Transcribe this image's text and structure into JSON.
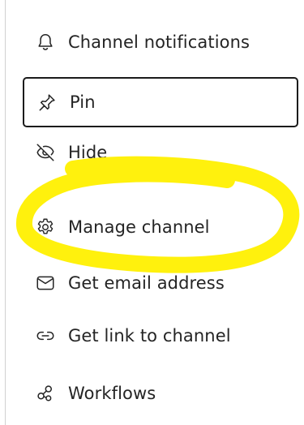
{
  "menu": {
    "items": [
      {
        "label": "Channel notifications",
        "icon": "bell-icon"
      },
      {
        "label": "Pin",
        "icon": "pin-icon"
      },
      {
        "label": "Hide",
        "icon": "eye-off-icon"
      },
      {
        "label": "Manage channel",
        "icon": "gear-icon"
      },
      {
        "label": "Get email address",
        "icon": "mail-icon"
      },
      {
        "label": "Get link to channel",
        "icon": "link-icon"
      },
      {
        "label": "Workflows",
        "icon": "workflows-icon"
      }
    ],
    "focused_item": "Pin"
  },
  "annotation": {
    "color": "#fff000"
  }
}
